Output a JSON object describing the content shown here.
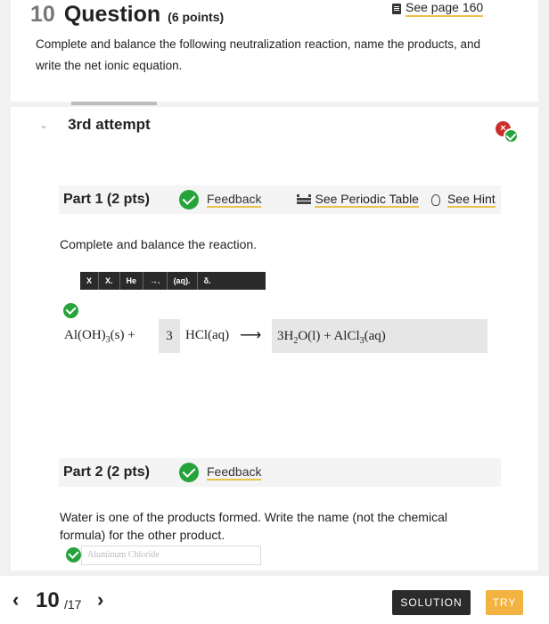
{
  "question": {
    "number": "10",
    "word": "Question",
    "points": "(6 points)",
    "see_page": "See page 160",
    "text": "Complete and balance the following neutralization reaction, name the products, and write the net ionic equation."
  },
  "attempt": {
    "label": "3rd attempt"
  },
  "part1": {
    "title": "Part 1 (2 pts)",
    "feedback": "Feedback",
    "periodic_table": "See Periodic Table",
    "hint": "See Hint",
    "instruction": "Complete and balance the reaction.",
    "toolbar": [
      "X",
      "X.",
      "He",
      "→.",
      "(aq).",
      "δ."
    ],
    "equation": {
      "reactant1": "Al(OH)",
      "reactant1_sub": "3",
      "reactant1_state": "(s) +",
      "coefficient": "3",
      "reactant2": "HCl(aq)",
      "arrow": "⟶",
      "product_coef": "3H",
      "product_sub1": "2",
      "product_mid": "O(l) + AlCl",
      "product_sub2": "3",
      "product_state": "(aq)"
    }
  },
  "part2": {
    "title": "Part 2 (2 pts)",
    "feedback": "Feedback",
    "question": "Water is one of the products formed. Write the name (not the chemical formula) for the other product.",
    "answer": "Aluminum Chloride"
  },
  "nav": {
    "prev": "‹",
    "current": "10",
    "total": "/17",
    "next": "›",
    "solution": "SOLUTION",
    "try": "TRY"
  },
  "colors": {
    "accent_underline": "#e8c04a",
    "correct": "#27a33c",
    "incorrect": "#c9302c",
    "try_button": "#f2b340"
  }
}
